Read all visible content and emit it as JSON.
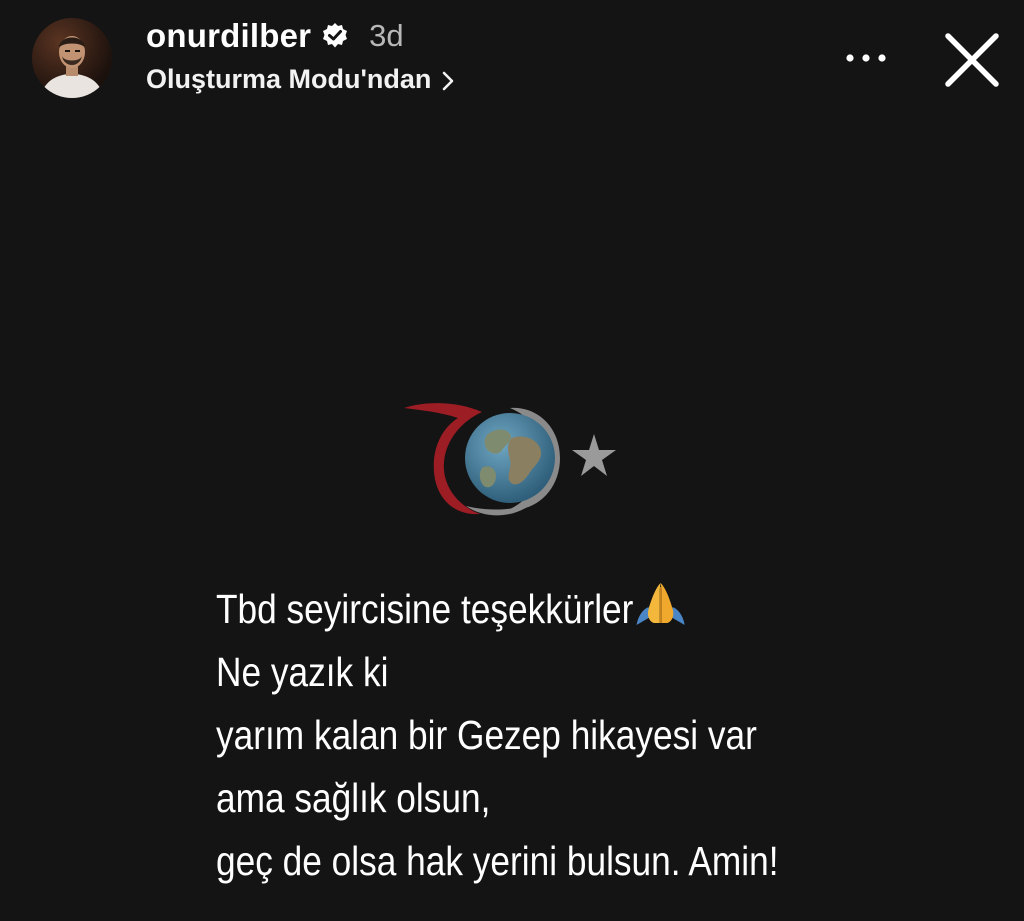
{
  "header": {
    "username": "onurdilber",
    "age": "3d",
    "subtitle": "Oluşturma Modu'ndan",
    "subtitle_icon": "chevron-right-icon",
    "verified_icon": "verified-badge-icon",
    "more_icon": "more-icon",
    "close_icon": "close-icon"
  },
  "story": {
    "caption_lines": [
      "Tbd seyircisine teşekkürler",
      "Ne yazık ki",
      "yarım kalan bir Gezep hikayesi var",
      "ama sağlık olsun,",
      "geç de olsa hak yerini bulsun. Amin!"
    ],
    "first_line_emoji": "folded-hands-icon"
  },
  "colors": {
    "background": "#141414",
    "text": "#ffffff",
    "muted_text": "#b8b8b8",
    "watermark_red": "#9c1d24",
    "watermark_grey": "#8a8a8a"
  }
}
